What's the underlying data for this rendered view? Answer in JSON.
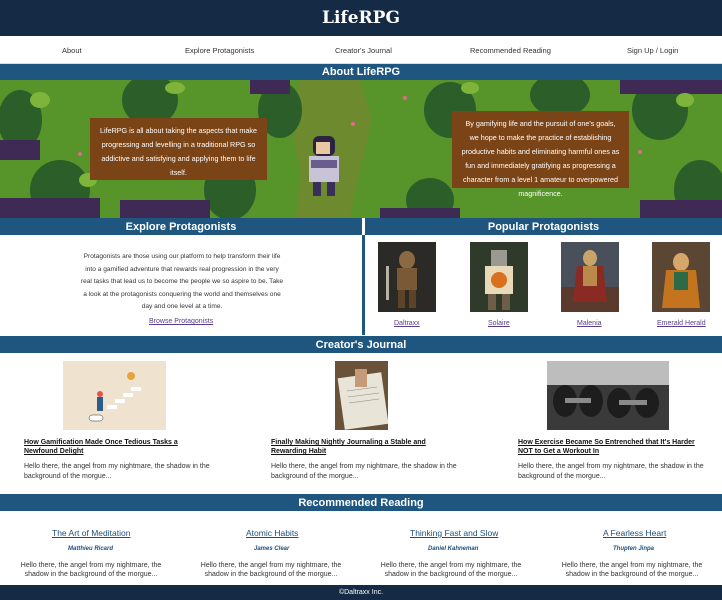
{
  "header": {
    "logo": "LifeRPG"
  },
  "nav": {
    "items": [
      {
        "label": "About"
      },
      {
        "label": "Explore Protagonists"
      },
      {
        "label": "Creator's Journal"
      },
      {
        "label": "Recommended Reading"
      },
      {
        "label": "Sign Up / Login"
      }
    ]
  },
  "about": {
    "heading": "About LifeRPG",
    "left_box": "LifeRPG is all about taking the aspects that make progressing and levelling in a traditional RPG so addictive and satisfying and applying them to life itself.",
    "right_box": "By gamifying life and the pursuit of one's goals, we hope to make the practice of establishing productive habits and eliminating harmful ones as fun and immediately gratifying as progressing a character from a level 1 amateur to overpowered magnificence."
  },
  "explore": {
    "heading": "Explore Protagonists",
    "body": "Protagonists are those using our platform to help transform their life into a gamified adventure that rewards real progression in the very real tasks that lead us to become the people we so aspire to be. Take a look at the protagonists conquering the world and themselves one day and one level at a time.",
    "link": "Browse Protagonists"
  },
  "popular": {
    "heading": "Popular Protagonists",
    "items": [
      {
        "name": "Daltraxx"
      },
      {
        "name": "Solaire"
      },
      {
        "name": "Malenia"
      },
      {
        "name": "Emerald Herald"
      }
    ]
  },
  "journal": {
    "heading": "Creator's Journal",
    "posts": [
      {
        "title": "How Gamification Made Once Tedious Tasks a Newfound Delight",
        "excerpt": "Hello there, the angel from my nightmare, the shadow in the background of the morgue..."
      },
      {
        "title": "Finally Making Nightly Journaling a Stable and Rewarding Habit",
        "excerpt": "Hello there, the angel from my nightmare, the shadow in the background of the morgue..."
      },
      {
        "title": "How Exercise Became So Entrenched that It's Harder NOT to Get a Workout In",
        "excerpt": "Hello there, the angel from my nightmare, the shadow in the background of the morgue..."
      }
    ]
  },
  "reading": {
    "heading": "Recommended Reading",
    "books": [
      {
        "title": "The Art of Meditation",
        "author": "Matthieu Ricard",
        "excerpt": "Hello there, the angel from my nightmare, the shadow in the background of the morgue..."
      },
      {
        "title": "Atomic Habits",
        "author": "James Clear",
        "excerpt": "Hello there, the angel from my nightmare, the shadow in the background of the morgue..."
      },
      {
        "title": "Thinking Fast and Slow",
        "author": "Daniel Kahneman",
        "excerpt": "Hello there, the angel from my nightmare, the shadow in the background of the morgue..."
      },
      {
        "title": "A Fearless Heart",
        "author": "Thupten Jinpa",
        "excerpt": "Hello there, the angel from my nightmare, the shadow in the background of the morgue..."
      }
    ]
  },
  "footer": {
    "text": "©Daltraxx Inc."
  },
  "colors": {
    "header_bg": "#142a45",
    "band_bg": "#1e567f",
    "hero_box": "#7b4416",
    "link": "#5a3d8a"
  }
}
